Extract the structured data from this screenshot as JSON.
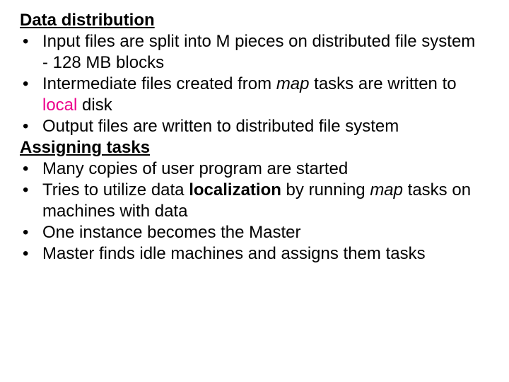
{
  "section1": {
    "heading": "Data distribution",
    "items": [
      {
        "t1": "Input files are split into M pieces on distributed file system - 128 MB blocks"
      },
      {
        "t1": "Intermediate files created from ",
        "t2": "map",
        "t3": " tasks are written to ",
        "t4": "local",
        "t5": " disk"
      },
      {
        "t1": "Output files are written to distributed file system"
      }
    ]
  },
  "section2": {
    "heading": "Assigning tasks",
    "items": [
      {
        "t1": "Many copies of user program are started"
      },
      {
        "t1": "Tries to utilize data ",
        "t2": "localization",
        "t3": " by running ",
        "t4": "map",
        "t5": " tasks on machines with data"
      },
      {
        "t1": "One instance becomes the Master"
      },
      {
        "t1": "Master finds idle machines and assigns them tasks"
      }
    ]
  }
}
